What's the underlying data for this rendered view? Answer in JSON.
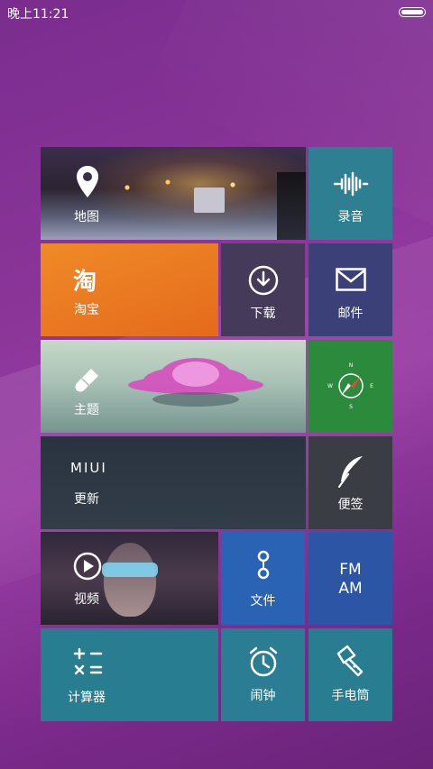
{
  "status_bar": {
    "time": "晚上11:21"
  },
  "tiles": {
    "map": {
      "label": "地图"
    },
    "recorder": {
      "label": "录音"
    },
    "taobao": {
      "label": "淘宝",
      "glyph": "淘"
    },
    "download": {
      "label": "下载"
    },
    "mail": {
      "label": "邮件"
    },
    "theme": {
      "label": "主题"
    },
    "compass": {
      "label": ""
    },
    "update": {
      "label": "更新",
      "brand": "MIUI"
    },
    "notes": {
      "label": "便签"
    },
    "video": {
      "label": "视频"
    },
    "files": {
      "label": "文件"
    },
    "fm": {
      "label": "FM\nAM"
    },
    "calculator": {
      "label": "计算器"
    },
    "clock": {
      "label": "闹钟"
    },
    "flashlight": {
      "label": "手电筒"
    }
  },
  "colors": {
    "recorder": "#2e7f92",
    "taobao": "#ea7b22",
    "download": "#473a5c",
    "mail": "#3b4178",
    "compass": "#2c8a3d",
    "update": "#2b3340",
    "notes": "#3b3d44",
    "files": "#2a63b3",
    "fm": "#2d55a6",
    "calculator": "#287d90",
    "clock": "#2a7d92",
    "flashlight": "#287d90"
  }
}
